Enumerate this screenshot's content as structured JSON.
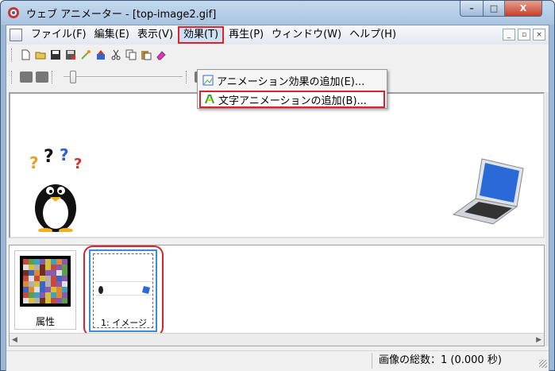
{
  "window": {
    "title": "ウェブ アニメーター - [top-image2.gif]",
    "controls": {
      "minimize": "–",
      "maximize": "□",
      "close": "X"
    }
  },
  "menubar": {
    "items": [
      {
        "label": "ファイル(F)"
      },
      {
        "label": "編集(E)"
      },
      {
        "label": "表示(V)"
      },
      {
        "label": "効果(T)"
      },
      {
        "label": "再生(P)"
      },
      {
        "label": "ウィンドウ(W)"
      },
      {
        "label": "ヘルプ(H)"
      }
    ],
    "mdi_controls": {
      "minimize": "_",
      "restore": "▫",
      "close": "×"
    }
  },
  "effects_menu": {
    "items": [
      {
        "label": "アニメーション効果の追加(E)...",
        "icon": "animation-effect-icon"
      },
      {
        "label": "文字アニメーションの追加(B)...",
        "icon": "text-animation-icon"
      }
    ]
  },
  "toolbar": {
    "icons": [
      "new-icon",
      "open-icon",
      "save-icon",
      "save-as-icon",
      "wizard-icon",
      "paint-icon",
      "cut-icon",
      "copy-icon",
      "paste-icon",
      "eraser-icon"
    ]
  },
  "frames": {
    "attributes_label": "属性",
    "frame_label": "1: イメージ"
  },
  "status": {
    "total_images": "画像の総数：1 (0.000 秒)"
  },
  "colors": {
    "highlight_red": "#e0202a",
    "selection_blue": "#3a8bdb"
  }
}
